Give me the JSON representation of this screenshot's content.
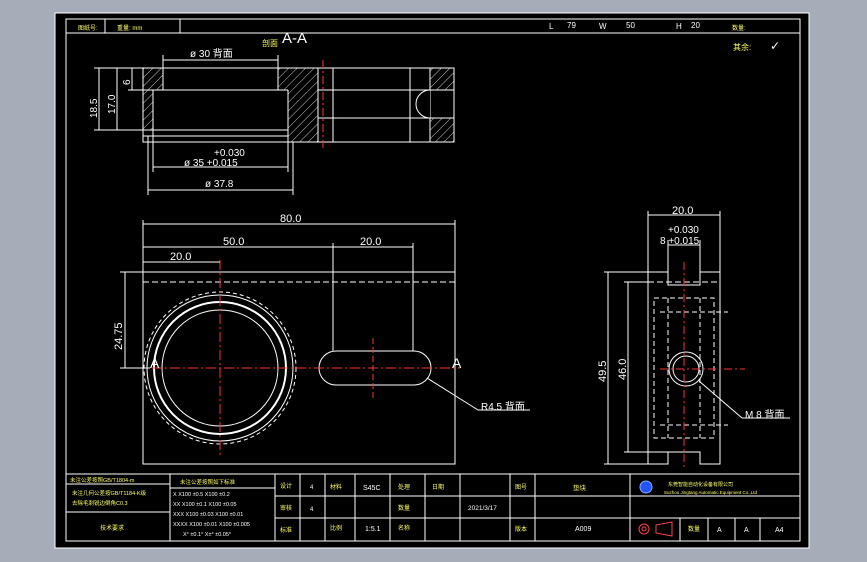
{
  "header": {
    "left_label_1": "图纸号:",
    "left_label_2": "重量: mm",
    "length_label": "L",
    "length_value": "79",
    "width_label": "W",
    "width_value": "50",
    "height_label": "H",
    "height_value": "20",
    "qty_label": "数量:"
  },
  "section": {
    "title": "A-A",
    "prefix": "剖面",
    "marker_left": "A",
    "marker_right": "A"
  },
  "surface_finish": {
    "label": "其余:",
    "symbol": "✓"
  },
  "top_view": {
    "d30": "ø 30 背面",
    "tol_upper": "+0.030",
    "d35": "ø 35 +0.015",
    "d378": "ø 37.8",
    "h185": "18.5",
    "h17": "17.0",
    "h6": "6"
  },
  "front_view": {
    "w80": "80.0",
    "w50": "50.0",
    "w20_right": "20.0",
    "w20_left": "20.0",
    "h2475": "24.75",
    "r45": "R4.5 背面"
  },
  "side_view": {
    "w20": "20.0",
    "tol_upper": "+0.030",
    "w8": "8 +0.015",
    "h495": "49.5",
    "h46": "46.0",
    "m8": "M 8 背面"
  },
  "title_block": {
    "notes": [
      "未注公差按照GB/T1804-m",
      "未注几何公差按GB/T1184-K级",
      "去除毛刺锐边倒角C0.3",
      "技术要求"
    ],
    "tolerance_title": "未注公差按照如下标准",
    "tolerance_rows": [
      "X    X100 ±0.5  X100 ±0.2",
      "XX   X100 ±0.1  X100 ±0.05",
      "XXX  X100 ±0.03 X100 ±0.01",
      "XXXX X100 ±0.01 X100 ±0.005",
      "X° ±0.1°   X±° ±0.05°"
    ],
    "material": "S45C",
    "date": "2021/3/17",
    "scale": "1:5.1",
    "drawing_no": "A009",
    "company": "东莞智能自动化设备有限公司",
    "company_en": "Suzhou Jingtang Automatic Equipment Co.,Ltd",
    "sheet": "A",
    "size": "A4",
    "revision": "A",
    "labels": [
      "设计",
      "审核",
      "标准",
      "日期",
      "材料",
      "比例",
      "名称",
      "图号",
      "处理",
      "数量",
      "版本"
    ],
    "part_name": "垫块",
    "row_nums": [
      "4",
      "4"
    ]
  }
}
